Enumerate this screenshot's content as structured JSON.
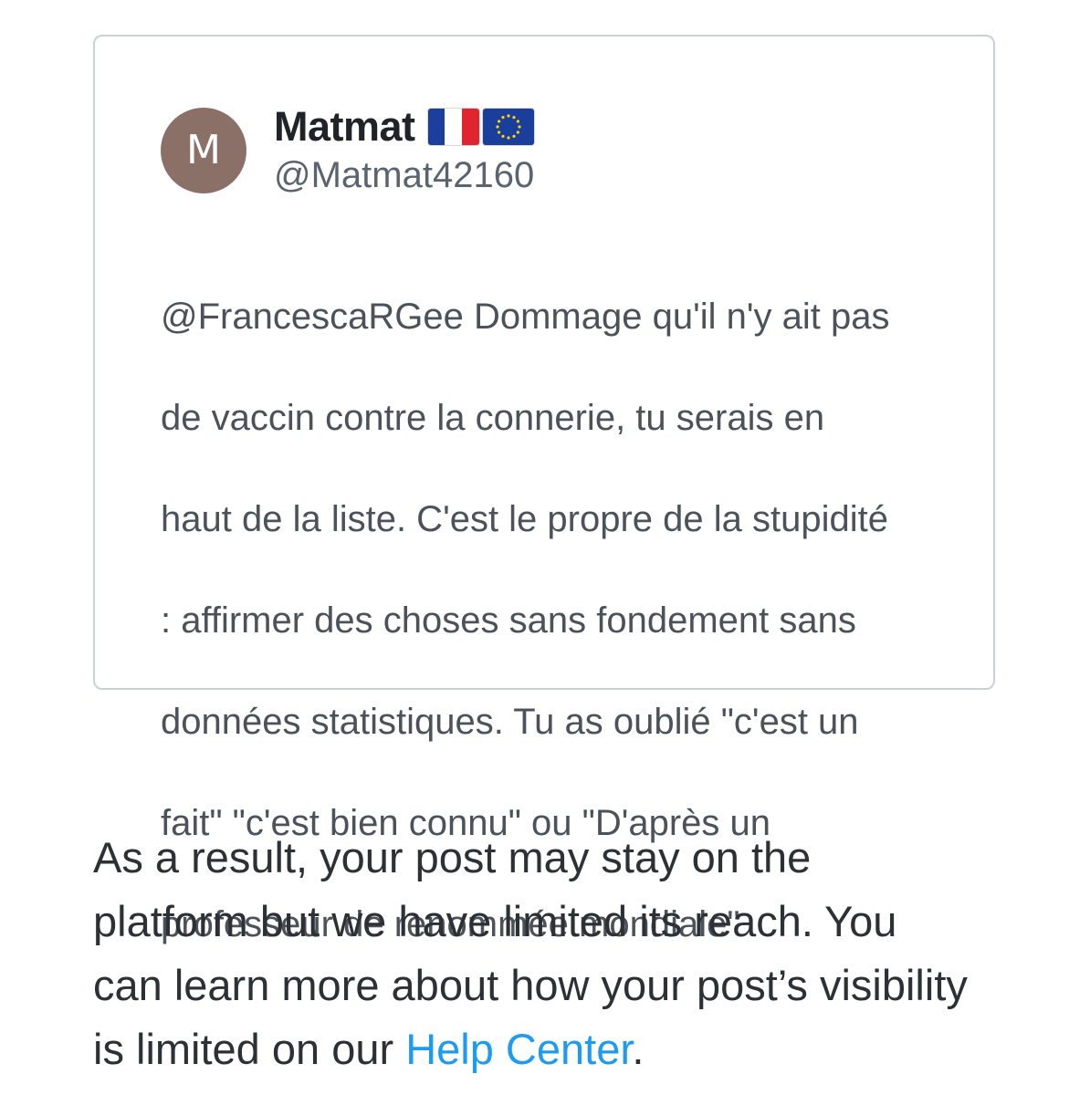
{
  "tweet": {
    "avatar_initial": "M",
    "display_name": "Matmat",
    "flags": [
      "french-flag-icon",
      "eu-flag-icon"
    ],
    "handle": "@Matmat42160",
    "text_lines": [
      "@FrancescaRGee Dommage qu'il n'y ait pas",
      "de vaccin contre la connerie, tu serais en",
      "haut de la liste. C'est le propre de la stupidité",
      ": affirmer des choses sans fondement sans",
      "données statistiques. Tu as oublié \"c'est un",
      "fait\" \"c'est bien connu\" ou \"D'après un",
      "professeur de renommée mondiale\""
    ]
  },
  "notice": {
    "line1": "As a result, your post may stay on the",
    "line2": "platform but we have limited its reach. You",
    "line3": "can learn more about how your post’s visibility",
    "line4_prefix": "is limited on our ",
    "link_label": "Help Center",
    "line4_suffix": "."
  },
  "colors": {
    "link": "#1d9bf0",
    "avatar": "#8a7067",
    "card_border": "#c9d0d6"
  }
}
